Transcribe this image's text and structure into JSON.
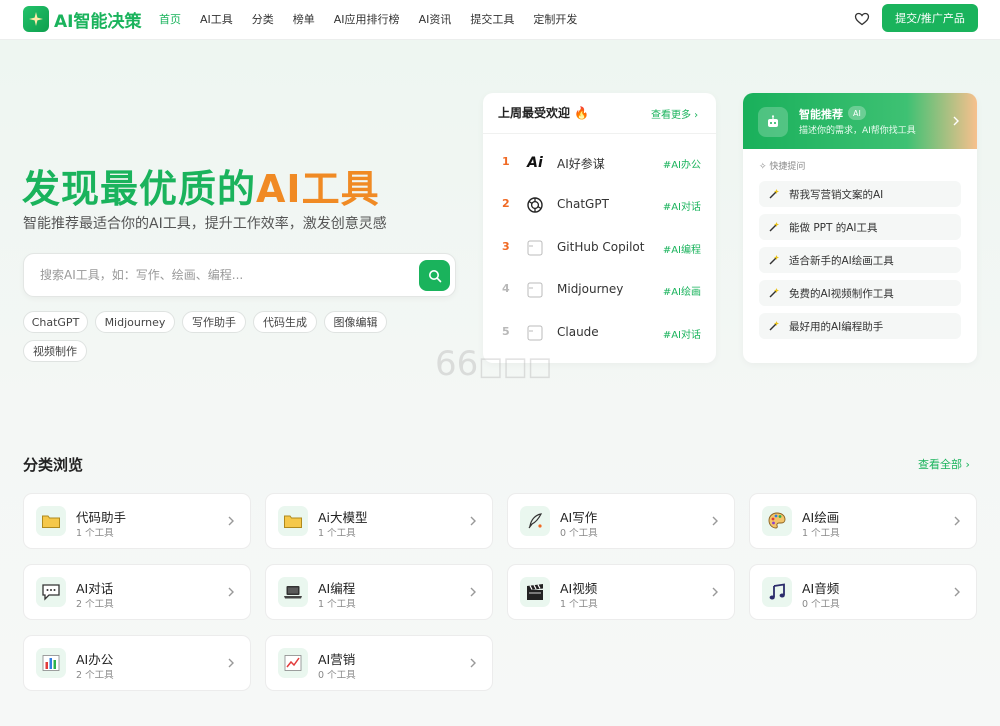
{
  "header": {
    "logo_text": "AI智能决策",
    "nav": [
      "首页",
      "AI工具",
      "分类",
      "榜单",
      "AI应用排行榜",
      "AI资讯",
      "提交工具",
      "定制开发"
    ],
    "submit_label": "提交/推广产品"
  },
  "hero": {
    "title_green": "发现最优质的",
    "title_orange": "AI工具",
    "subtitle": "智能推荐最适合你的AI工具，提升工作效率，激发创意灵感",
    "search_placeholder": "搜索AI工具，如：写作、绘画、编程...",
    "tags": [
      "ChatGPT",
      "Midjourney",
      "写作助手",
      "代码生成",
      "图像编辑",
      "视频制作"
    ]
  },
  "popular": {
    "title": "上周最受欢迎",
    "more": "查看更多",
    "items": [
      {
        "rank": "1",
        "name": "AI好参谋",
        "tag": "#AI办公",
        "color": "#f06a24"
      },
      {
        "rank": "2",
        "name": "ChatGPT",
        "tag": "#AI对话",
        "color": "#f06a24"
      },
      {
        "rank": "3",
        "name": "GitHub Copilot",
        "tag": "#AI编程",
        "color": "#f06a24"
      },
      {
        "rank": "4",
        "name": "Midjourney",
        "tag": "#AI绘画",
        "color": "#b8b8b8"
      },
      {
        "rank": "5",
        "name": "Claude",
        "tag": "#AI对话",
        "color": "#b8b8b8"
      }
    ]
  },
  "smart": {
    "title": "智能推荐",
    "badge": "AI",
    "desc": "描述你的需求，AI帮你找工具",
    "quick_label": "快捷提问",
    "quick": [
      "帮我写营销文案的AI",
      "能做 PPT 的AI工具",
      "适合新手的AI绘画工具",
      "免费的AI视频制作工具",
      "最好用的AI编程助手"
    ]
  },
  "watermark": "66",
  "categories": {
    "title": "分类浏览",
    "more": "查看全部",
    "items": [
      {
        "name": "代码助手",
        "count": "1 个工具",
        "icon": "folder-icon"
      },
      {
        "name": "Ai大模型",
        "count": "1 个工具",
        "icon": "folder-icon"
      },
      {
        "name": "AI写作",
        "count": "0 个工具",
        "icon": "quill-icon"
      },
      {
        "name": "AI绘画",
        "count": "1 个工具",
        "icon": "palette-icon"
      },
      {
        "name": "AI对话",
        "count": "2 个工具",
        "icon": "chat-icon"
      },
      {
        "name": "AI编程",
        "count": "1 个工具",
        "icon": "laptop-icon"
      },
      {
        "name": "AI视频",
        "count": "1 个工具",
        "icon": "clapper-icon"
      },
      {
        "name": "AI音频",
        "count": "0 个工具",
        "icon": "music-icon"
      },
      {
        "name": "AI办公",
        "count": "2 个工具",
        "icon": "bar-chart-icon"
      },
      {
        "name": "AI营销",
        "count": "0 个工具",
        "icon": "line-chart-icon"
      }
    ]
  },
  "colors": {
    "brand": "#1ab35c",
    "accent": "#f08a24"
  }
}
